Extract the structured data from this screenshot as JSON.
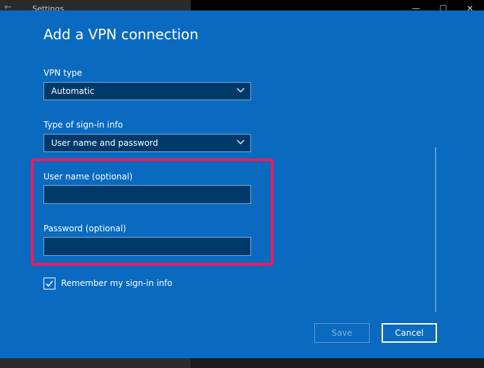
{
  "window": {
    "title": "Settings",
    "back_icon": "back-arrow-icon",
    "minimize_icon": "minimize-icon",
    "maximize_icon": "maximize-icon",
    "close_icon": "close-icon"
  },
  "page": {
    "heading": "Add a VPN connection"
  },
  "form": {
    "vpn_type": {
      "label": "VPN type",
      "selected": "Automatic"
    },
    "sign_in_type": {
      "label": "Type of sign-in info",
      "selected": "User name and password"
    },
    "username": {
      "label": "User name (optional)",
      "value": ""
    },
    "password": {
      "label": "Password (optional)",
      "value": ""
    },
    "remember": {
      "label": "Remember my sign-in info",
      "checked": true
    }
  },
  "actions": {
    "save_label": "Save",
    "cancel_label": "Cancel"
  },
  "colors": {
    "panel_bg": "#0a6abf",
    "field_bg": "#003a6b",
    "highlight_border": "#ee1b5c"
  }
}
